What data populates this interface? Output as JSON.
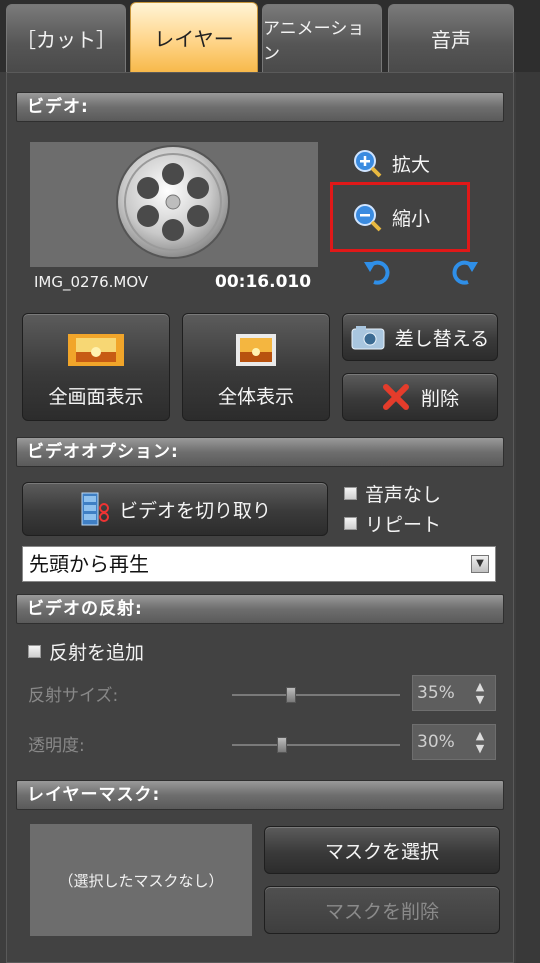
{
  "tabs": [
    {
      "label": "［カット］",
      "active": false
    },
    {
      "label": "レイヤー",
      "active": true
    },
    {
      "label": "アニメーション",
      "active": false
    },
    {
      "label": "音声",
      "active": false
    }
  ],
  "video": {
    "section_title": "ビデオ:",
    "filename": "IMG_0276.MOV",
    "duration": "00:16.010",
    "zoom_in_label": "拡大",
    "zoom_out_label": "縮小",
    "fullscreen_label": "全画面表示",
    "fit_label": "全体表示",
    "replace_label": "差し替える",
    "delete_label": "削除"
  },
  "video_options": {
    "section_title": "ビデオオプション:",
    "trim_label": "ビデオを切り取り",
    "mute_label": "音声なし",
    "repeat_label": "リピート",
    "play_mode_value": "先頭から再生"
  },
  "reflection": {
    "section_title": "ビデオの反射:",
    "add_label": "反射を追加",
    "size_label": "反射サイズ:",
    "size_value": "35%",
    "size_level": 0.35,
    "opacity_label": "透明度:",
    "opacity_value": "30%",
    "opacity_level": 0.3
  },
  "layer_mask": {
    "section_title": "レイヤーマスク:",
    "empty_text": "（選択したマスクなし）",
    "select_label": "マスクを選択",
    "delete_label": "マスクを削除"
  },
  "colors": {
    "active_tab": "#ffd58a",
    "highlight_box": "#e01818",
    "undo_redo": "#2f8fe8"
  },
  "icons": [
    "zoom-in-icon",
    "zoom-out-icon",
    "undo-icon",
    "redo-icon",
    "film-reel-icon",
    "camera-icon",
    "delete-x-icon",
    "trim-scissors-icon",
    "fullscreen-icon",
    "fit-screen-icon"
  ]
}
